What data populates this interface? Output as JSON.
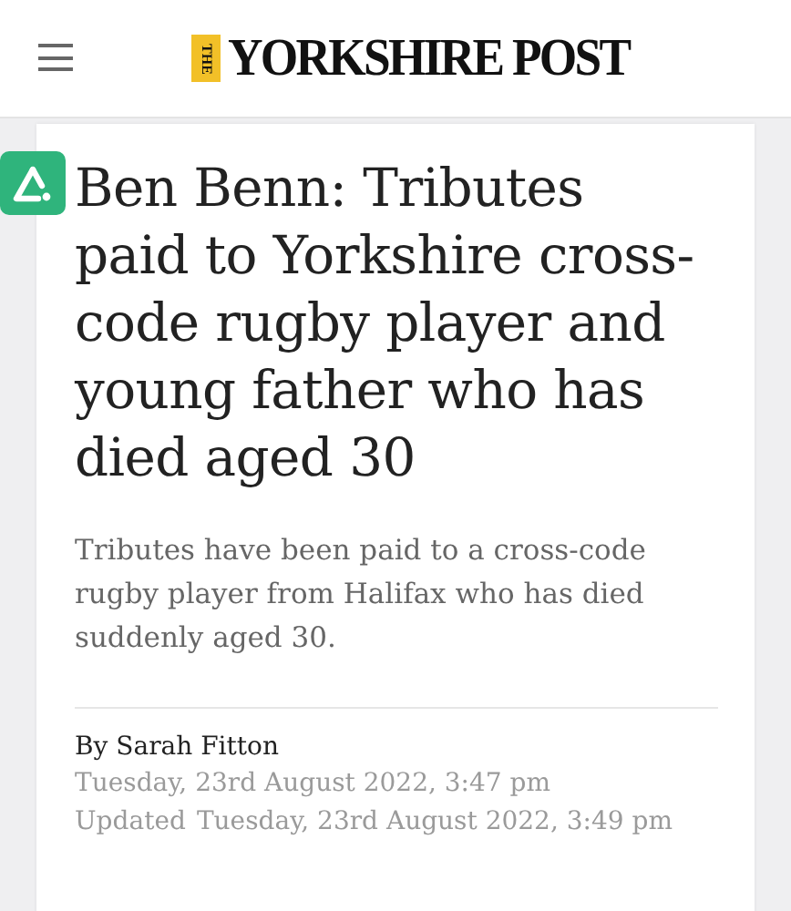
{
  "header": {
    "logo": {
      "prefix": "THE",
      "name": "YORKSHIRE POST"
    }
  },
  "article": {
    "headline": "Ben Benn: Tributes paid to Yorkshire cross-code rugby player and young father who has died aged 30",
    "summary": "Tributes have been paid to a cross-code rugby player from Halifax who has died suddenly aged 30.",
    "byline": "By Sarah Fitton",
    "published": "Tuesday, 23rd August 2022, 3:47 pm",
    "updated_label": "Updated",
    "updated": "Tuesday, 23rd August 2022, 3:49 pm"
  }
}
